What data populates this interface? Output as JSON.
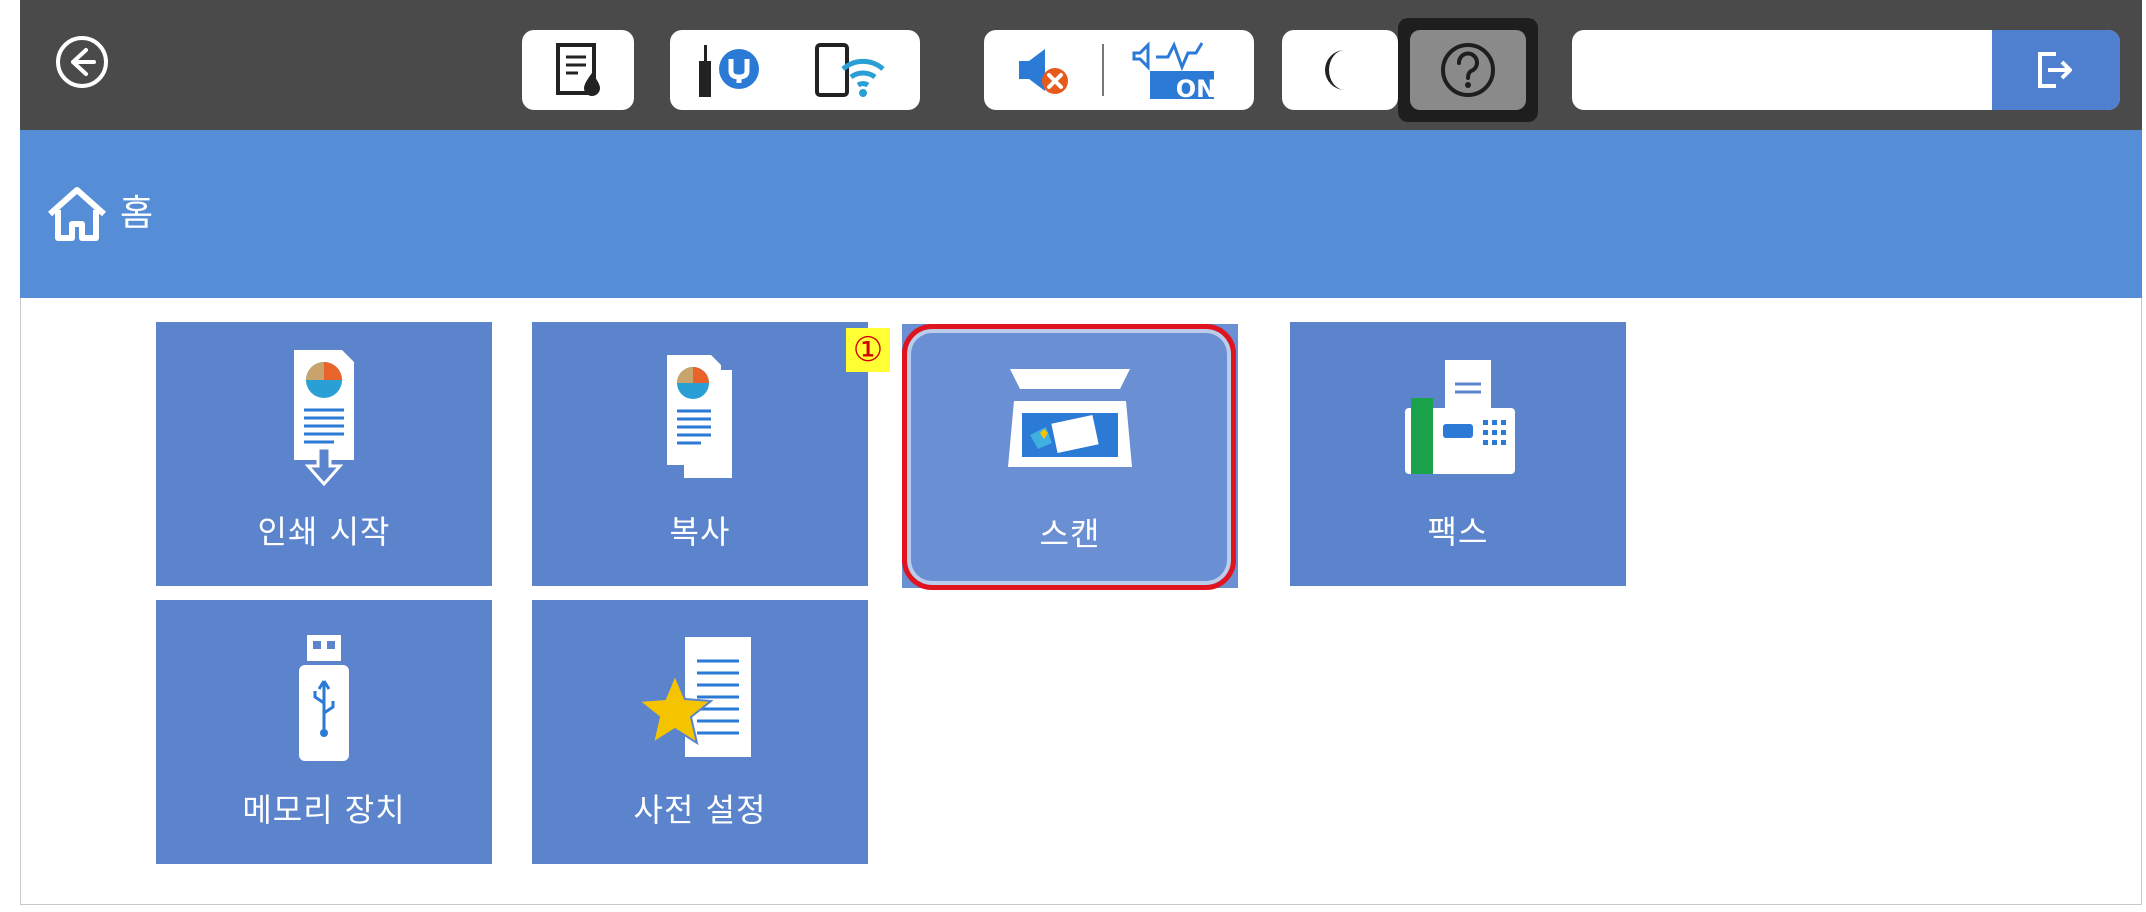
{
  "topbar": {
    "icons": {
      "back": "back-arrow-icon",
      "ink": "ink-level-icon",
      "network": "network-status-icon",
      "wifi": "wifi-icon",
      "mute": "sound-muted-icon",
      "quiet_mode": "quiet-mode-on-icon",
      "sleep": "sleep-moon-icon",
      "help": "help-icon",
      "login": "login-icon"
    },
    "quiet_mode_text": "ON",
    "login_value": ""
  },
  "titlebar": {
    "title": "홈"
  },
  "tiles": [
    {
      "label": "인쇄 시작",
      "icon": "print-start-icon"
    },
    {
      "label": "복사",
      "icon": "copy-icon"
    },
    {
      "label": "스캔",
      "icon": "scan-icon",
      "selected": true
    },
    {
      "label": "팩스",
      "icon": "fax-icon"
    },
    {
      "label": "메모리 장치",
      "icon": "usb-memory-icon"
    },
    {
      "label": "사전 설정",
      "icon": "presets-icon"
    }
  ],
  "annotation": {
    "step": "①"
  },
  "colors": {
    "topbar": "#4a4a4a",
    "titlebar": "#558ed6",
    "tile": "#5b84cc",
    "highlight": "#e0141e",
    "badge": "#ffff33"
  }
}
